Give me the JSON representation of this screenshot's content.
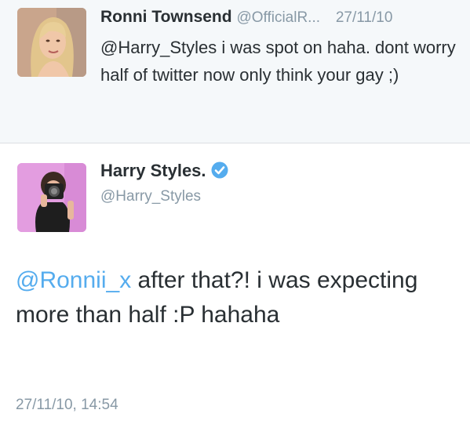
{
  "tweet1": {
    "name": "Ronni Townsend",
    "handle": "@OfficialR...",
    "date": "27/11/10",
    "text": "@Harry_Styles i was spot on haha. dont worry half of twitter now only think your gay ;)"
  },
  "tweet2": {
    "name": "Harry Styles.",
    "handle": "@Harry_Styles",
    "verified_icon": "verified-badge-icon",
    "mention": "@Ronnii_x",
    "text": " after that?! i was expecting more than half :P hahaha",
    "timestamp": "27/11/10, 14:54"
  },
  "colors": {
    "link": "#55acee",
    "meta": "#8899a6",
    "text": "#292f33",
    "top_background": "#f5f8fa"
  }
}
